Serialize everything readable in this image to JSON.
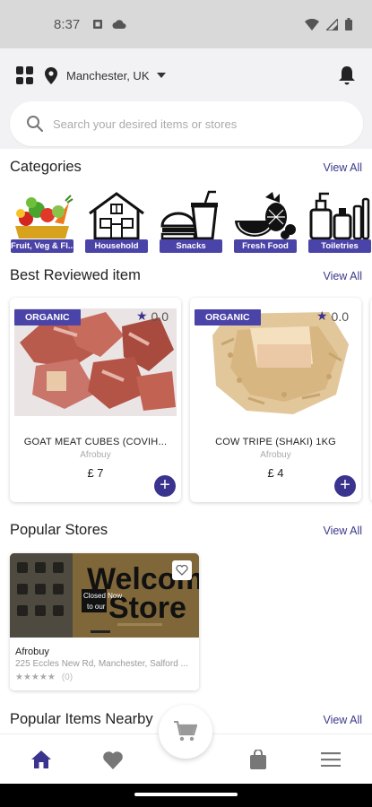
{
  "status_bar": {
    "time": "8:37"
  },
  "header": {
    "location": "Manchester, UK",
    "search_placeholder": "Search your desired items or stores"
  },
  "categories": {
    "title": "Categories",
    "view_all": "View All",
    "items": [
      {
        "label": "Fruit, Veg & Fl...",
        "icon": "fruit-veg-icon"
      },
      {
        "label": "Household",
        "icon": "house-icon"
      },
      {
        "label": "Snacks",
        "icon": "snacks-icon"
      },
      {
        "label": "Fresh Food",
        "icon": "fresh-food-icon"
      },
      {
        "label": "Toiletries",
        "icon": "toiletries-icon"
      }
    ]
  },
  "best_reviewed": {
    "title": "Best Reviewed item",
    "view_all": "View All",
    "products": [
      {
        "badge": "ORGANIC",
        "rating": "0.0",
        "name": "GOAT MEAT CUBES (COVIH...",
        "store": "Afrobuy",
        "price": "£ 7"
      },
      {
        "badge": "ORGANIC",
        "rating": "0.0",
        "name": "COW TRIPE (SHAKI) 1KG",
        "store": "Afrobuy",
        "price": "£ 4"
      }
    ]
  },
  "popular_stores": {
    "title": "Popular Stores",
    "view_all": "View All",
    "stores": [
      {
        "name": "Afrobuy",
        "address": "225 Eccles New Rd, Manchester, Salford ...",
        "rating_count": "(0)",
        "banner_big": "Welcome",
        "banner_big2": "Store",
        "banner_small": "Closed Now",
        "banner_small2": "to our"
      }
    ]
  },
  "popular_nearby": {
    "title": "Popular Items Nearby",
    "view_all": "View All"
  },
  "colors": {
    "accent": "#4b44a8",
    "button": "#3a348f",
    "link": "#3a3a8c"
  }
}
